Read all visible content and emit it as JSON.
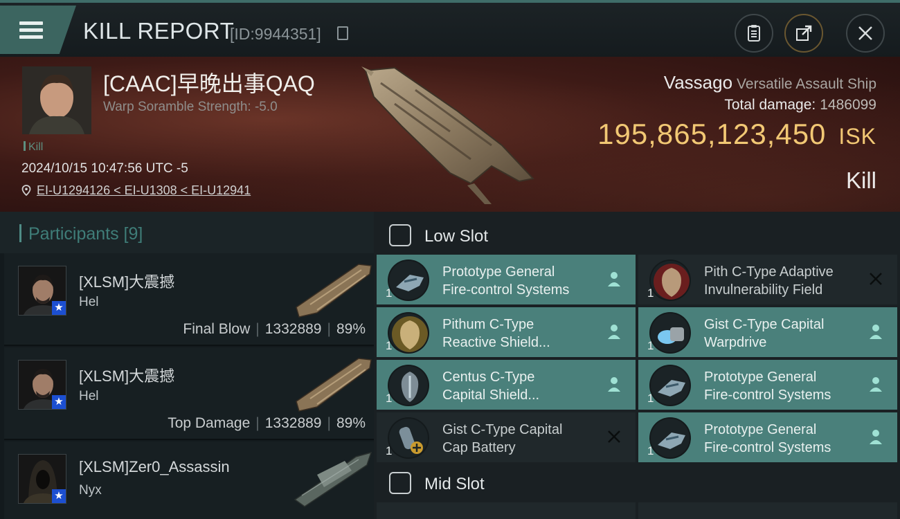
{
  "header": {
    "title": "KILL REPORT",
    "id_text": "[ID:9944351]"
  },
  "victim": {
    "name": "[CAAC]早晚出事QAQ",
    "subtitle": "Warp Soramble Strength: -5.0",
    "tag": "Kill",
    "time": "2024/10/15 10:47:56 UTC -5",
    "location": "EI-U1294126 < EI-U1308 < EI-U12941",
    "ship_name": "Vassago",
    "ship_class": "Versatile Assault Ship",
    "total_damage_label": "Total damage:",
    "total_damage": "1486099",
    "isk_value": "195,865,123,450",
    "isk_unit": "ISK",
    "result": "Kill"
  },
  "participants": {
    "title": "Participants [9]",
    "rows": [
      {
        "name": "[XLSM]大震撼",
        "ship": "Hel",
        "role": "Final Blow",
        "damage": "1332889",
        "percent": "89%"
      },
      {
        "name": "[XLSM]大震撼",
        "ship": "Hel",
        "role": "Top Damage",
        "damage": "1332889",
        "percent": "89%"
      },
      {
        "name": "[XLSM]Zer0_Assassin",
        "ship": "Nyx"
      }
    ]
  },
  "fittings": {
    "low_slot_label": "Low Slot",
    "mid_slot_label": "Mid Slot",
    "low": [
      {
        "line1": "Prototype General",
        "line2": "Fire-control Systems",
        "qty": "1",
        "state": "dropped"
      },
      {
        "line1": "Pith C-Type Adaptive",
        "line2": "Invulnerability Field",
        "qty": "1",
        "state": "destroyed"
      },
      {
        "line1": "Pithum C-Type",
        "line2": "Reactive Shield...",
        "qty": "1",
        "state": "dropped"
      },
      {
        "line1": "Gist C-Type Capital",
        "line2": "Warpdrive",
        "qty": "1",
        "state": "dropped"
      },
      {
        "line1": "Centus C-Type",
        "line2": "Capital Shield...",
        "qty": "1",
        "state": "dropped"
      },
      {
        "line1": "Prototype General",
        "line2": "Fire-control Systems",
        "qty": "1",
        "state": "dropped"
      },
      {
        "line1": "Gist C-Type Capital",
        "line2": "Cap Battery",
        "qty": "1",
        "state": "destroyed"
      },
      {
        "line1": "Prototype General",
        "line2": "Fire-control Systems",
        "qty": "1",
        "state": "dropped"
      }
    ]
  },
  "colors": {
    "accent_teal": "#4a807b",
    "isk_gold": "#f2c874",
    "banner_red": "#3d1a16"
  }
}
